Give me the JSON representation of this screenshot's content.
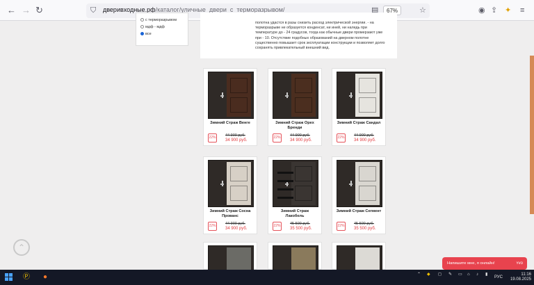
{
  "browser": {
    "url_host": "двеpивходные.рф",
    "url_path": "/каталог/уличные_двери_с_терморазрывом/",
    "zoom": "67%",
    "nav": {
      "back": "←",
      "forward": "→",
      "reload": "↻"
    }
  },
  "filter": {
    "options": [
      {
        "label": "с терморазрывом",
        "selected": false
      },
      {
        "label": "мдф - мдф",
        "selected": false
      },
      {
        "label": "все",
        "selected": true
      }
    ]
  },
  "info": {
    "text": "полотна удастся в разы снизить расход электрической энергии. - на терморазрыве не образуется конденсат, ни иней, ни наледь при температуре до - 24 градусов, тогда как обычные двери промерзают уже при - 10. Отсутствие подобных образований на дверном полотне существенно повышает срок эксплуатации конструкции и позволяет долго сохранять привлекательный внешний вид."
  },
  "products": [
    {
      "name": "Зимний Страж Венге",
      "discount": "22%",
      "old_price": "44 900 руб.",
      "new_price": "34 900 руб.",
      "leaf_color": "#4a2c1f"
    },
    {
      "name": "Зимний Страж Орех Бренди",
      "discount": "22%",
      "old_price": "44 900 руб.",
      "new_price": "34 900 руб.",
      "leaf_color": "#4b2e1f"
    },
    {
      "name": "Зимний Страж Сандал",
      "discount": "22%",
      "old_price": "44 900 руб.",
      "new_price": "34 900 руб.",
      "leaf_color": "#e6e4df"
    },
    {
      "name": "Зимний Страж Сосна Прованс",
      "discount": "22%",
      "old_price": "44 900 руб.",
      "new_price": "34 900 руб.",
      "leaf_color": "#d7d0c6"
    },
    {
      "name": "Зимний Страж Лакобель",
      "discount": "22%",
      "old_price": "45 500 руб.",
      "new_price": "35 500 руб.",
      "leaf_color": "#3a3532"
    },
    {
      "name": "Зимний Страж Сегмент",
      "discount": "22%",
      "old_price": "45 500 руб.",
      "new_price": "35 500 руб.",
      "leaf_color": "#d9d6d0"
    }
  ],
  "chat": {
    "label": "Напишите мне, я онлайн!"
  },
  "taskbar": {
    "lang": "РУС",
    "time": "11:16",
    "date": "19.08.2025"
  }
}
